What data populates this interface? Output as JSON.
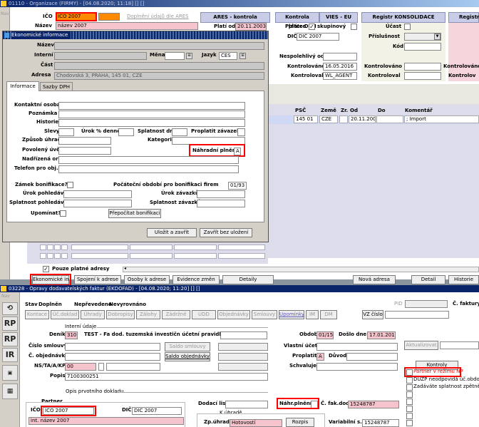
{
  "top_window": {
    "title": "01110 - Organizace (FIRMY) - [04.08.2020; 11:18] [] []",
    "side_nav": "Nav",
    "ico_label": "IČO",
    "ico_value": "IČO 2007",
    "nazev_label": "Název",
    "nazev_value": "název 2007",
    "ares_link": "Doplnění údajů dle ARES",
    "ares_header": "ARES - kontrola",
    "plati_od_label": "Platí od",
    "plati_od_value": "20.11.2003",
    "kontrola_platce": "Kontrola plátce",
    "vies": "VIES - EU",
    "platce_dph": "Plátce DPH",
    "skupinovy": "skupinový",
    "dic_label": "DIČ",
    "dic_value": "DIČ 2007",
    "nespolehlivy": "Nespolehlivý od",
    "kontrolovano": "Kontrolováno",
    "kontrolovano_value": "16.05.2016",
    "kontroloval": "Kontroloval",
    "kontroloval_value": "WL_AGENT",
    "registr_konsolidace": "Registr KONSOLIDACE",
    "ucast": "Účast",
    "prislusnost": "Příslušnost",
    "kod": "Kód",
    "kontrolovano2": "Kontrolováno",
    "kontroloval2": "Kontroloval",
    "registr": "Registr",
    "kontrolovano3": "Kontrolováno",
    "kontroloval3": "Kontrolov",
    "grid_headers": [
      "PSČ",
      "Země",
      "Zr.",
      "Od",
      "Do",
      "Komentář"
    ],
    "grid_row": [
      "145 01",
      "CZE",
      "",
      "20.11.2003",
      "",
      "; Import"
    ],
    "pouze_platne": "Pouze platné adresy",
    "buttons": [
      "Ekonomické inf.",
      "Spojení k adrese",
      "Osoby k adrese",
      "Evidence změn",
      "Detaily",
      "Nová adresa",
      "Detail",
      "Historie"
    ]
  },
  "dialog": {
    "title": "Ekonomické informace",
    "nazev": "Název",
    "interni": "Interní",
    "mena": "Měna",
    "jazyk": "Jazyk",
    "jazyk_value": "ČES",
    "cast": "Část",
    "adresa": "Adresa",
    "adresa_value": "Chodovská 3, PRAHA, 145 01, CZE",
    "tabs": [
      "Informace",
      "Sazby DPH"
    ],
    "kontaktni_osoba": "Kontaktní osoba",
    "poznamka": "Poznámka",
    "historie": "Historie",
    "slevy": "Slevy",
    "urok_denne": "Úrok % denně",
    "splatnost_dni": "Splatnost dní",
    "proplatit_zavazek": "Proplatit závazek",
    "zpusob_uhrady": "Způsob úhrady",
    "kategorie": "Kategorie",
    "povoleny_uver": "Povolený úvěr",
    "nahradni_plneni": "Náhradní plnění",
    "nahradni_plneni_value": "A",
    "nadrizena_org": "Nadřízená org.",
    "telefon": "Telefon pro obj.",
    "zamek": "Zámek bonifikace?",
    "pocatecni": "Počáteční období pro bonifikaci firem",
    "pocatecni_value": "01/93",
    "urok_pohledavek": "Úrok pohledávek",
    "urok_zavazku": "Úrok závazků",
    "splatnost_pohledavek": "Splatnost pohledávek",
    "splatnost_zavazku": "Splatnost závazků",
    "upominat": "Upomínat?",
    "prepocitat": "Přepočítat bonifikaci",
    "ulozit": "Uložit a zavřít",
    "zavrit": "Zavřít bez uložení"
  },
  "bottom_window": {
    "title": "03228 - Opravy dodavatelských faktur (EKDOFAD) - [04.08.2020; 11:20] [] []",
    "side_nav": "Nav",
    "stav": "Stav",
    "stav_value": "Doplněn",
    "neprevedeno": "Nepřevedeno",
    "nevyrovnano": "Nevyrovnáno",
    "toolbar": [
      "Kontace",
      "Úč.doklad",
      "Úhrady",
      "Dobropisy",
      "Zálohy",
      "Zádržné",
      "UDD",
      "Objednávky",
      "Smlouvy",
      "Upomínky",
      "IM",
      "DM"
    ],
    "pid": "PID",
    "c_faktury": "Č. faktury",
    "vz_cislo": "VZ číslo",
    "interni_udaje": "Interní údaje",
    "denik_label": "Deník",
    "denik_value": "310",
    "denik_text": "TEST - Fa dod. tuzemská investičn účetní pravidlo",
    "obdobi": "Období",
    "obdobi_value": "01/15",
    "doslo_dne": "Došlo dne",
    "doslo_dne_value": "17.01.2015",
    "cislo_smlouvy": "Číslo smlouvy",
    "saldo_smlouvy": "Saldo smlouvy",
    "vlastni_ucet": "Vlastní účet",
    "aktualizovat": "Aktualizovat",
    "c_objednavky": "Č. objednávky",
    "saldo_objednavky": "Saldo objednávky",
    "proplatit": "Proplatit",
    "proplatit_value": "A",
    "duvod": "Důvod",
    "ns_label": "NS/TA/A/KP",
    "ns_value": "00",
    "schvaluje": "Schvaluje",
    "kontroly": "Kontroly",
    "popis": "Popis",
    "popis_value": "7100300251",
    "opis": "Opis prvotního dokladu",
    "partner_np": "Partner v režimu NP",
    "duzp": "DUZP neodpovídá úč.období",
    "zadavate": "Zadáváte splatnost zpětně",
    "partner": "Partner",
    "ico_label": "IČO",
    "ico_value": "IČO 2007",
    "dic_label": "DIČ",
    "dic_value": "DIČ 2007",
    "int_nazev": "int. název 2007",
    "dodaci_list": "Dodací list",
    "nahr_plneni": "Náhr.plnění",
    "c_fak_dod": "Č. fak.dod",
    "c_fak_dod_value": "15248787",
    "k_uhrade": "K úhradě",
    "zp_uhrady": "Zp.úhrady",
    "zp_uhrady_value": "Hotovostí",
    "rozpis": "Rozpis",
    "variabilni": "Variabilní s.",
    "variabilni_value": "15248787",
    "side_icons": [
      "RP",
      "RP",
      "IR"
    ]
  },
  "colors": {
    "title_bar": "#0a246a",
    "highlight_red": "#ff0000",
    "pink_field": "#f6c4cc",
    "orange_field": "#ff8a00"
  }
}
